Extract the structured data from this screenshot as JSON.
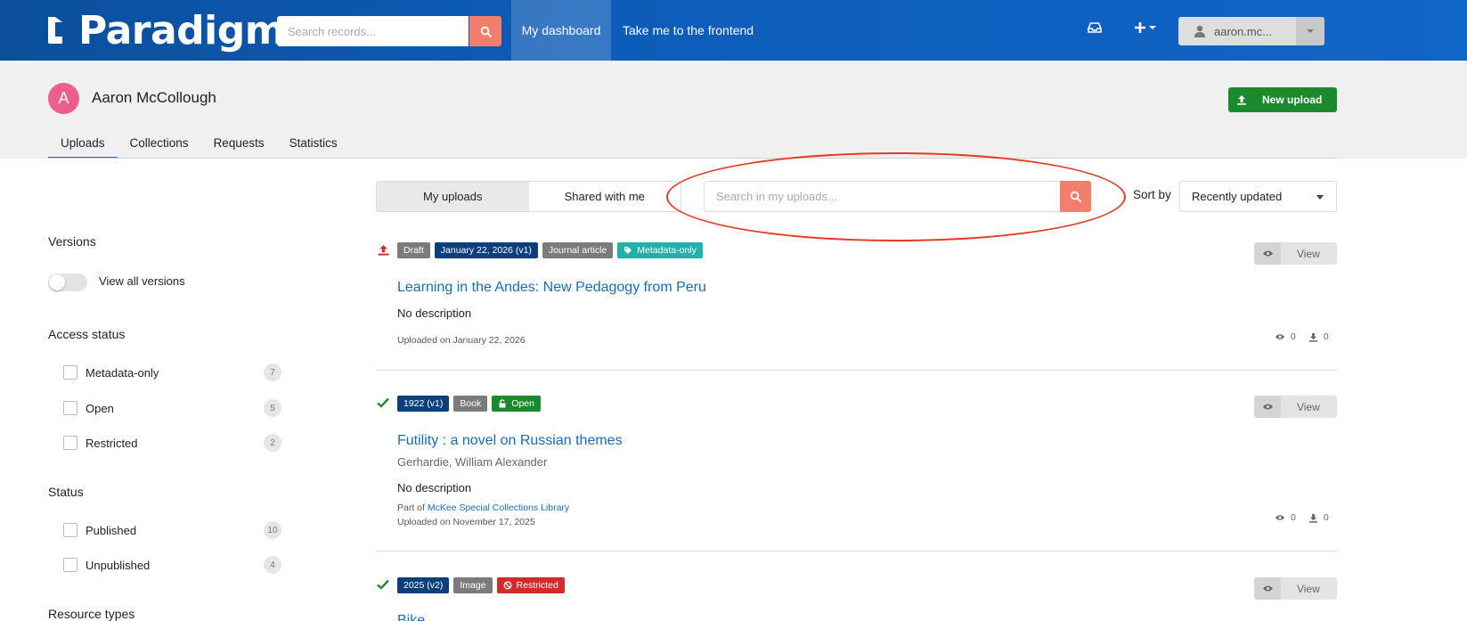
{
  "navbar": {
    "brand": "Paradigm",
    "search_placeholder": "Search records...",
    "links": [
      "My dashboard",
      "Take me to the frontend"
    ],
    "user": "aaron.mc..."
  },
  "header": {
    "avatar_letter": "A",
    "user_name": "Aaron McCollough",
    "new_upload": "New upload",
    "tabs": [
      "Uploads",
      "Collections",
      "Requests",
      "Statistics"
    ]
  },
  "sidebar": {
    "versions_heading": "Versions",
    "versions_toggle": "View all versions",
    "access_heading": "Access status",
    "access": [
      {
        "label": "Metadata-only",
        "count": "7"
      },
      {
        "label": "Open",
        "count": "5"
      },
      {
        "label": "Restricted",
        "count": "2"
      }
    ],
    "status_heading": "Status",
    "status": [
      {
        "label": "Published",
        "count": "10"
      },
      {
        "label": "Unpublished",
        "count": "4"
      }
    ],
    "resource_heading": "Resource types"
  },
  "toolbar": {
    "my_uploads": "My uploads",
    "shared": "Shared with me",
    "search_placeholder": "Search in my uploads...",
    "sort_label": "Sort by",
    "sort_value": "Recently updated"
  },
  "records": [
    {
      "labels": [
        "Draft",
        "January 22, 2026 (v1)",
        "Journal article",
        "Metadata-only"
      ],
      "title": "Learning in the Andes: New Pedagogy from Peru",
      "description": "No description",
      "uploaded": "Uploaded on January 22, 2026",
      "views": "0",
      "downloads": "0",
      "view_label": "View"
    },
    {
      "labels": [
        "1922 (v1)",
        "Book",
        "Open"
      ],
      "title": "Futility : a novel on Russian themes",
      "creator": "Gerhardie, William Alexander",
      "description": "No description",
      "part_of_prefix": "Part of",
      "part_of": "McKee Special Collections Library",
      "uploaded": "Uploaded on November 17, 2025",
      "views": "0",
      "downloads": "0",
      "view_label": "View"
    },
    {
      "labels": [
        "2025 (v2)",
        "Image",
        "Restricted"
      ],
      "title": "Bike",
      "view_label": "View"
    }
  ],
  "colors": {
    "navbar": "#0d5cb8",
    "search_button": "#f47e6e",
    "new_upload": "#1b8a2f",
    "label_navy": "#0d3f7c",
    "label_grey": "#7b7b7b",
    "label_teal": "#20b2aa",
    "label_green": "#1b8a2f",
    "label_red": "#d42a2a",
    "link": "#1a6bb8",
    "annotation": "#e53a22"
  }
}
